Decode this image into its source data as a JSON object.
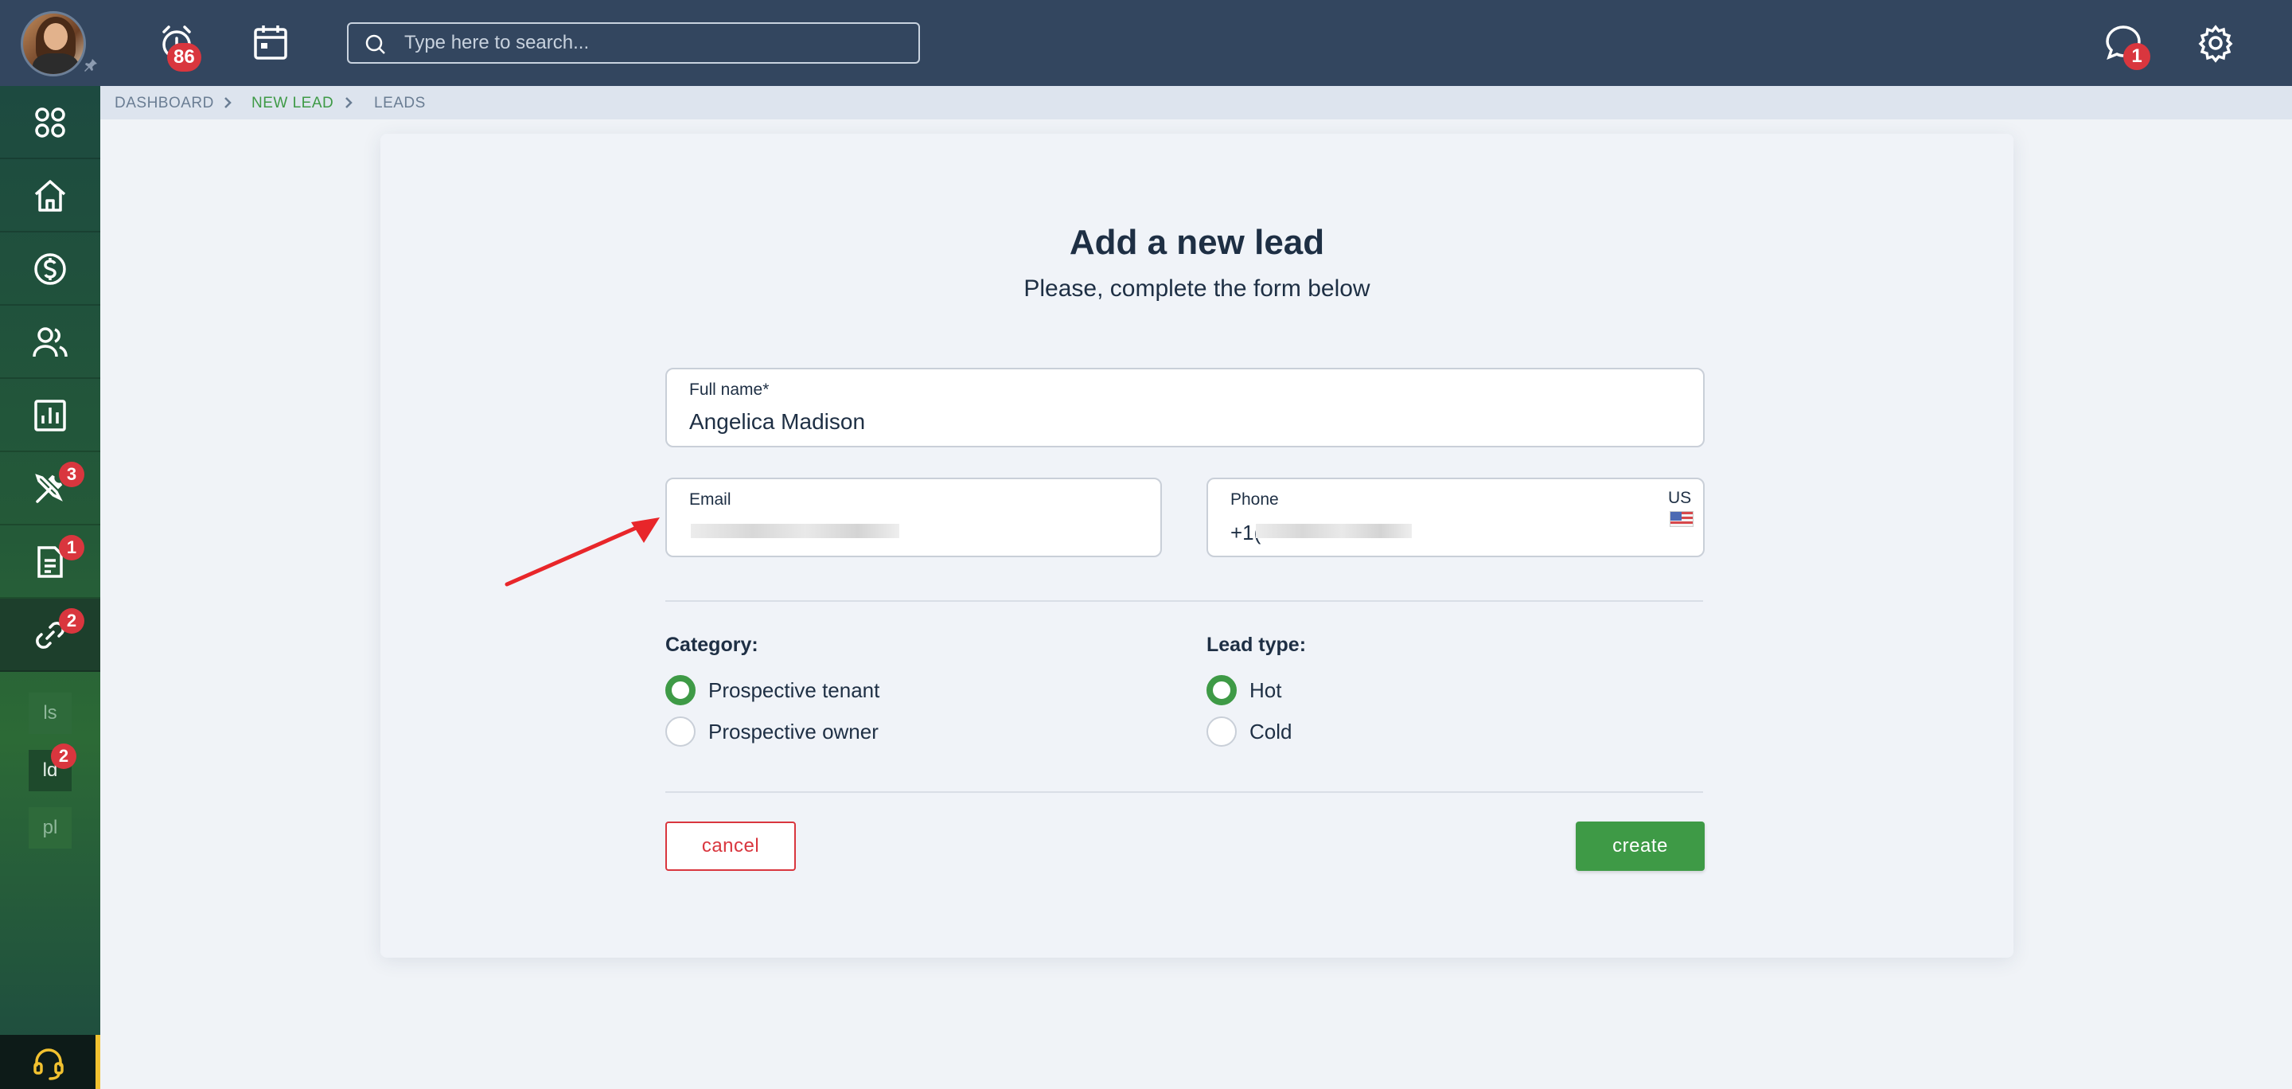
{
  "topbar": {
    "alarm_badge": "86",
    "search_placeholder": "Type here to search...",
    "messages_badge": "1"
  },
  "sidebar": {
    "items": [
      {
        "icon": "apps-grid-icon"
      },
      {
        "icon": "home-icon"
      },
      {
        "icon": "dollar-icon"
      },
      {
        "icon": "users-icon"
      },
      {
        "icon": "chart-icon"
      },
      {
        "icon": "tools-icon",
        "badge": "3"
      },
      {
        "icon": "document-icon",
        "badge": "1"
      },
      {
        "icon": "link-icon",
        "badge": "2"
      }
    ],
    "subitems": [
      {
        "label": "ls"
      },
      {
        "label": "ld",
        "badge": "2"
      },
      {
        "label": "pl"
      }
    ]
  },
  "breadcrumb": {
    "items": [
      "DASHBOARD",
      "NEW LEAD",
      "LEADS"
    ]
  },
  "form": {
    "title": "Add a new lead",
    "subtitle": "Please, complete the form below",
    "fullname_label": "Full name*",
    "fullname_value": "Angelica Madison",
    "email_label": "Email",
    "phone_label": "Phone",
    "phone_prefix": "+1(",
    "phone_country": "US",
    "category_label": "Category:",
    "category_options": [
      "Prospective tenant",
      "Prospective owner"
    ],
    "category_selected": "Prospective tenant",
    "leadtype_label": "Lead type:",
    "leadtype_options": [
      "Hot",
      "Cold"
    ],
    "leadtype_selected": "Hot",
    "cancel_label": "cancel",
    "create_label": "create"
  },
  "colors": {
    "topbar": "#33465f",
    "accent_green": "#3e9a46",
    "badge_red": "#d9363e",
    "annotation_arrow": "#e8262a"
  }
}
